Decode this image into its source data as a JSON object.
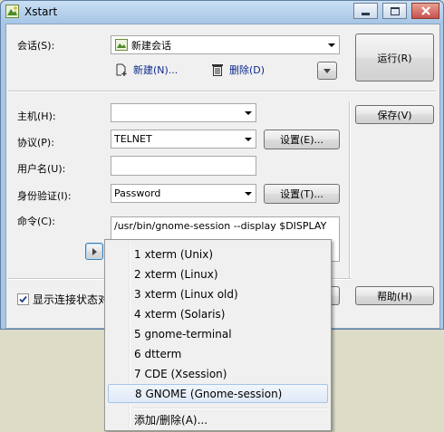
{
  "window": {
    "title": "Xstart"
  },
  "session": {
    "label": "会话(S):",
    "value": "新建会话",
    "new_link": "新建(N)...",
    "delete_link": "删除(D)",
    "run_button": "运行(R)"
  },
  "form": {
    "host_label": "主机(H):",
    "host_value": "",
    "protocol_label": "协议(P):",
    "protocol_value": "TELNET",
    "protocol_settings": "设置(E)...",
    "username_label": "用户名(U):",
    "username_value": "",
    "auth_label": "身份验证(I):",
    "auth_value": "Password",
    "auth_settings": "设置(T)...",
    "command_label": "命令(C):",
    "command_value": "/usr/bin/gnome-session --display $DISPLAY"
  },
  "side": {
    "save_button": "保存(V)",
    "help_button": "帮助(H)"
  },
  "footer": {
    "show_status_label": "显示连接状态对",
    "show_status_checked": true
  },
  "command_menu": {
    "items": [
      "1 xterm (Unix)",
      "2 xterm (Linux)",
      "3 xterm (Linux old)",
      "4 xterm (Solaris)",
      "5 gnome-terminal",
      "6 dtterm",
      "7 CDE (Xsession)",
      "8 GNOME (Gnome-session)"
    ],
    "selected_index": 7,
    "add_remove": "添加/删除(A)..."
  },
  "colors": {
    "titlebar": "#a7c6e6",
    "close_button": "#c75050",
    "link": "#0b2a8c",
    "menu_highlight": "#dfe9f7"
  }
}
